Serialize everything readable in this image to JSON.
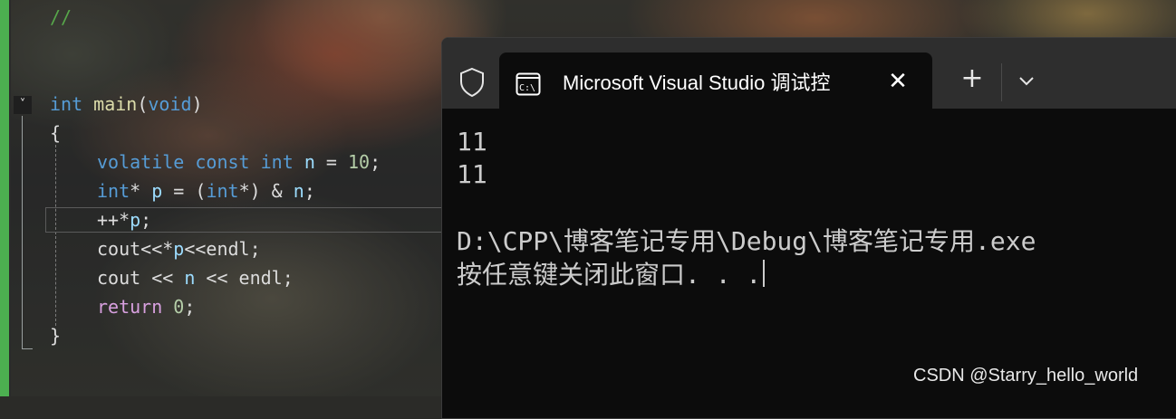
{
  "editor": {
    "lines": {
      "comment": "//",
      "main_kw": "int",
      "main_fn": "main",
      "main_open": "(",
      "main_param": "void",
      "main_close": ")",
      "brace_open": "{",
      "l1_kw1": "volatile",
      "l1_kw2": "const",
      "l1_kw3": "int",
      "l1_id": "n",
      "l1_eq": " = ",
      "l1_num": "10",
      "l1_semi": ";",
      "l2_kw": "int",
      "l2_star": "* ",
      "l2_id": "p",
      "l2_eq": " = (",
      "l2_kw2": "int",
      "l2_rest": "*) & ",
      "l2_id2": "n",
      "l2_semi": ";",
      "l3_op": "++*",
      "l3_id": "p",
      "l3_semi": ";",
      "l4_a": "cout<<*",
      "l4_id": "p",
      "l4_b": "<<endl;",
      "l5_a": "cout << ",
      "l5_id": "n",
      "l5_b": " << endl;",
      "l6_kw": "return",
      "l6_num": "0",
      "l6_semi": ";",
      "brace_close": "}"
    },
    "fold_glyph": "˅"
  },
  "terminal": {
    "tab_title": "Microsoft Visual Studio 调试控",
    "tab_close": "✕",
    "new_tab": "+",
    "output": {
      "line1": "11",
      "line2": "11",
      "line3": "D:\\CPP\\博客笔记专用\\Debug\\博客笔记专用.exe",
      "line4": "按任意键关闭此窗口. . ."
    }
  },
  "watermark": "CSDN @Starry_hello_world",
  "colors": {
    "terminal_bg": "#0c0c0c",
    "tabbar_bg": "#2e2e2e",
    "keyword": "#569cd6",
    "function": "#dcdcaa",
    "number": "#b5cea8",
    "control": "#d8a0df",
    "comment": "#57a64a",
    "gutter_accent": "#4caf50"
  },
  "icons": [
    "shield-icon",
    "terminal-icon",
    "close-icon",
    "plus-icon",
    "chevron-down-icon",
    "fold-toggle-icon"
  ]
}
